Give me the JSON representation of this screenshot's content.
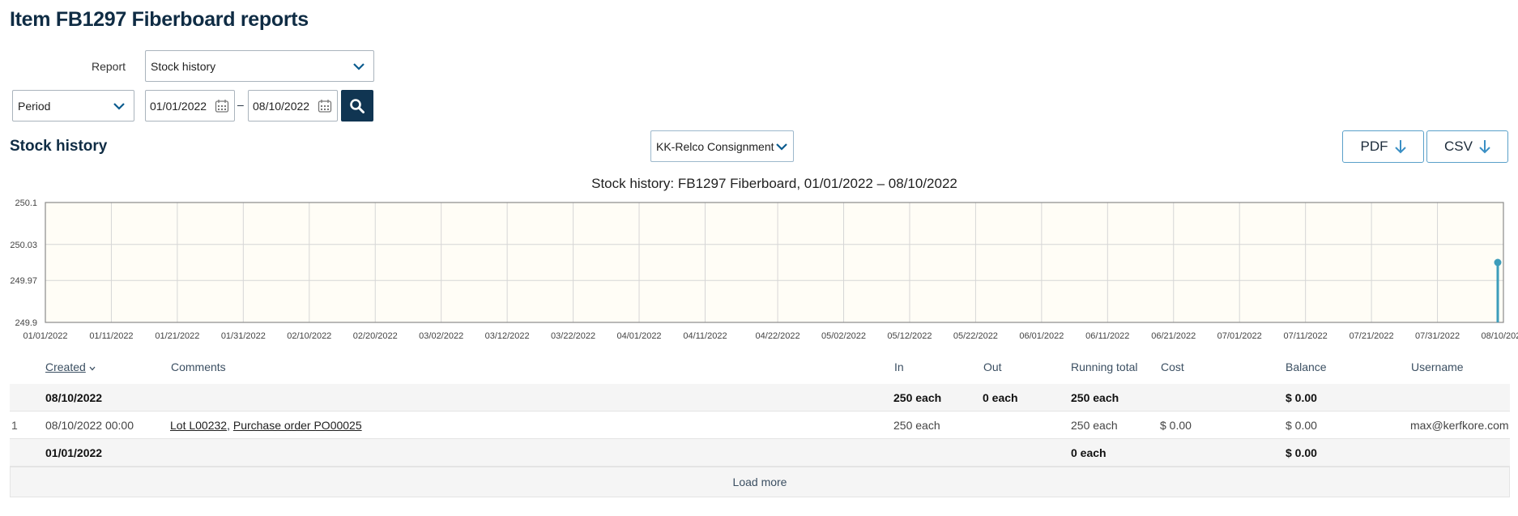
{
  "page": {
    "title": "Item FB1297 Fiberboard reports"
  },
  "filters": {
    "report_label": "Report",
    "report_value": "Stock history",
    "period_value": "Period",
    "date_from": "01/01/2022",
    "date_sep": "–",
    "date_to": "08/10/2022"
  },
  "section": {
    "title": "Stock history",
    "location_value": "KK-Relco Consignment",
    "pdf_label": "PDF",
    "csv_label": "CSV"
  },
  "chart_data": {
    "type": "line",
    "title": "Stock history: FB1297 Fiberboard, 01/01/2022 – 08/10/2022",
    "xlabel": "",
    "ylabel": "",
    "x_ticks": [
      "01/01/2022",
      "01/11/2022",
      "01/21/2022",
      "01/31/2022",
      "02/10/2022",
      "02/20/2022",
      "03/02/2022",
      "03/12/2022",
      "03/22/2022",
      "04/01/2022",
      "04/11/2022",
      "04/22/2022",
      "05/02/2022",
      "05/12/2022",
      "05/22/2022",
      "06/01/2022",
      "06/11/2022",
      "06/21/2022",
      "07/01/2022",
      "07/11/2022",
      "07/21/2022",
      "07/31/2022",
      "08/10/2022"
    ],
    "y_ticks": [
      "250.1",
      "250.03",
      "249.97",
      "249.9"
    ],
    "ylim": [
      249.9,
      250.1
    ],
    "grid": true,
    "series": [
      {
        "x": [
          "08/10/2022",
          "08/10/2022"
        ],
        "y": [
          249.9,
          250.0
        ]
      }
    ],
    "colors": {
      "line": "#3d9dbb",
      "plot_bg": "#fffdf6",
      "grid": "#d6d6d6"
    }
  },
  "table": {
    "headers": {
      "created": "Created",
      "comments": "Comments",
      "in": "In",
      "out": "Out",
      "running_total": "Running total",
      "cost": "Cost",
      "balance": "Balance",
      "username": "Username"
    },
    "summary_top": {
      "date": "08/10/2022",
      "in": "250 each",
      "out": "0 each",
      "running_total": "250 each",
      "balance": "$ 0.00"
    },
    "rows": [
      {
        "index": "1",
        "created": "08/10/2022 00:00",
        "lot_link": "Lot L00232",
        "sep": ", ",
        "po_link": "Purchase order PO00025",
        "in": "250 each",
        "running_total": "250 each",
        "cost": "$ 0.00",
        "balance": "$ 0.00",
        "username": "max@kerfkore.com"
      }
    ],
    "summary_bottom": {
      "date": "01/01/2022",
      "running_total": "0 each",
      "balance": "$ 0.00"
    },
    "load_more": "Load more"
  },
  "icons": {
    "chevron": "chevron-down-icon",
    "calendar": "calendar-icon",
    "search": "search-icon",
    "download": "arrow-down-icon",
    "sort": "sort-down-icon"
  }
}
